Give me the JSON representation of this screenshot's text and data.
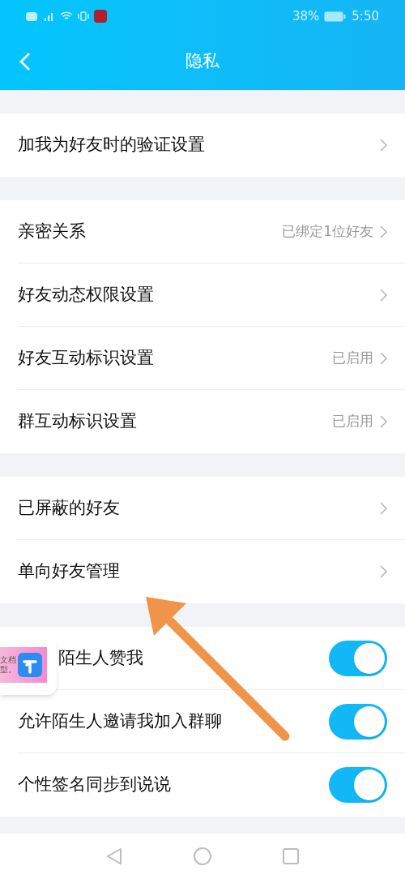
{
  "status_bar": {
    "battery": "38%",
    "time": "5:50"
  },
  "header": {
    "title": "隐私"
  },
  "sections": [
    {
      "items": [
        {
          "kind": "link",
          "label": "加我为好友时的验证设置"
        }
      ]
    },
    {
      "items": [
        {
          "kind": "link",
          "label": "亲密关系",
          "value": "已绑定1位好友"
        },
        {
          "kind": "link",
          "label": "好友动态权限设置"
        },
        {
          "kind": "link",
          "label": "好友互动标识设置",
          "value": "已启用"
        },
        {
          "kind": "link",
          "label": "群互动标识设置",
          "value": "已启用"
        }
      ]
    },
    {
      "items": [
        {
          "kind": "link",
          "label": "已屏蔽的好友"
        },
        {
          "kind": "link",
          "label": "单向好友管理"
        }
      ]
    },
    {
      "items": [
        {
          "kind": "toggle",
          "label": "陌生人赞我",
          "on": true
        },
        {
          "kind": "toggle",
          "label": "允许陌生人邀请我加入群聊",
          "on": true
        },
        {
          "kind": "toggle",
          "label": "个性签名同步到说说",
          "on": true
        }
      ]
    }
  ],
  "floating_widget": {
    "line_1": "文档",
    "line_2": "型。"
  }
}
